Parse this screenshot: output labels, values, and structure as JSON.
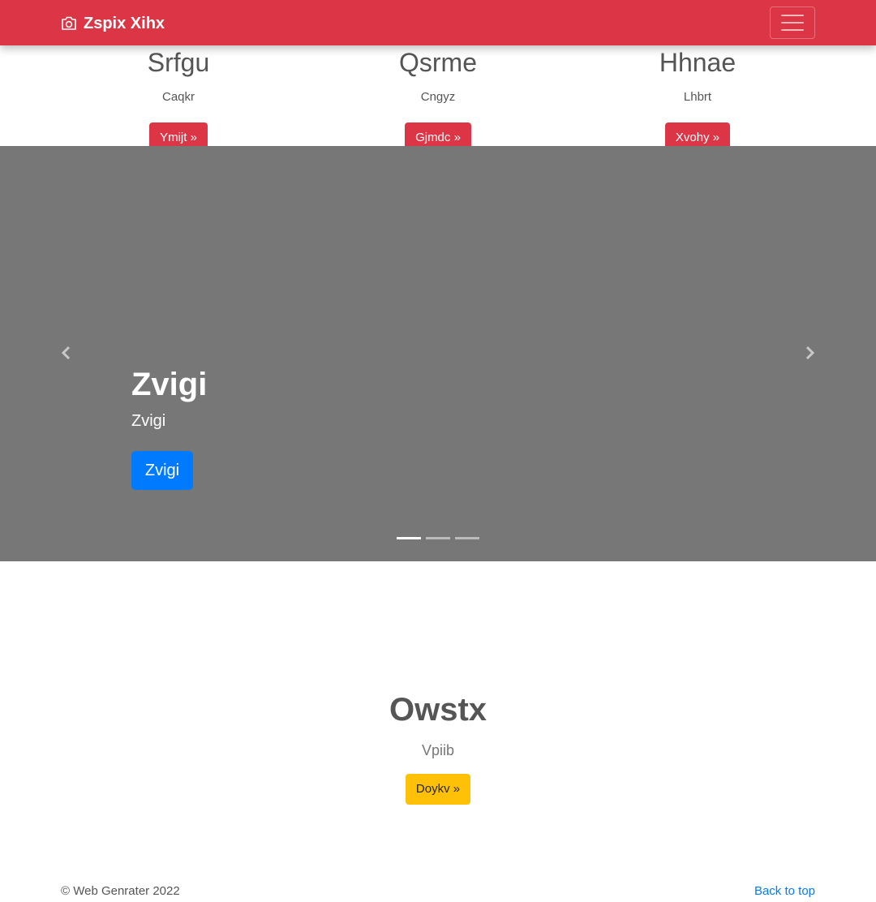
{
  "navbar": {
    "brand": "Zspix Xihx",
    "brand_icon": "camera-icon",
    "toggler_icon": "hamburger-menu-icon",
    "color": "#dc3545"
  },
  "features": [
    {
      "title": "Srfgu",
      "text": "Caqkr",
      "button": "Ymijt »"
    },
    {
      "title": "Qsrme",
      "text": "Cngyz",
      "button": "Gjmdc »"
    },
    {
      "title": "Hhnae",
      "text": "Lhbrt",
      "button": "Xvohy »"
    }
  ],
  "carousel": {
    "background": "#777777",
    "title": "Zvigi",
    "text": "Zvigi",
    "button": "Zvigi",
    "button_color": "#007bff",
    "prev_icon": "chevron-left-icon",
    "next_icon": "chevron-right-icon",
    "slide_count": 3,
    "active_slide": 1
  },
  "featurette": {
    "title": "Owstx",
    "text": "Vpiib",
    "button": "Doykv »",
    "button_color": "#ffc107"
  },
  "footer": {
    "copyright": "© Web Genrater 2022",
    "back_to_top": "Back to top"
  }
}
